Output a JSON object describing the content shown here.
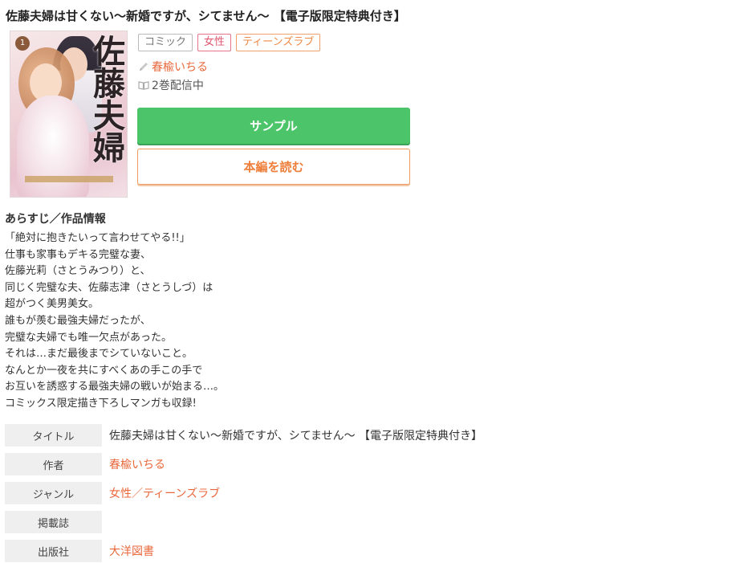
{
  "title": "佐藤夫婦は甘くない〜新婚ですが、シてません〜 【電子版限定特典付き】",
  "cover": {
    "volume_badge": "1",
    "title_text": "佐藤夫婦"
  },
  "tags": [
    "コミック",
    "女性",
    "ティーンズラブ"
  ],
  "author": "春楡いちる",
  "volumes": "2巻配信中",
  "buttons": {
    "sample": "サンプル",
    "read": "本編を読む"
  },
  "synopsis": {
    "heading": "あらすじ／作品情報",
    "lines": [
      "「絶対に抱きたいって言わせてやる!!」",
      "仕事も家事もデキる完璧な妻、",
      "佐藤光莉（さとうみつり）と、",
      "同じく完璧な夫、佐藤志津（さとうしづ）は",
      "超がつく美男美女。",
      "誰もが羨む最強夫婦だったが、",
      "完璧な夫婦でも唯一欠点があった。",
      "それは…まだ最後までシていないこと。",
      "なんとか一夜を共にすべくあの手この手で",
      "お互いを誘惑する最強夫婦の戦いが始まる…。",
      "コミックス限定描き下ろしマンガも収録!"
    ]
  },
  "info": {
    "title_label": "タイトル",
    "title_value": "佐藤夫婦は甘くない〜新婚ですが、シてません〜 【電子版限定特典付き】",
    "author_label": "作者",
    "author_value": "春楡いちる",
    "genre_label": "ジャンル",
    "genre_value": "女性／ティーンズラブ",
    "magazine_label": "掲載誌",
    "magazine_value": "",
    "publisher_label": "出版社",
    "publisher_value": "大洋図書"
  },
  "colors": {
    "accent_orange": "#e9683c",
    "sample_green": "#4cc46a",
    "tag_pink": "#e0566f",
    "tag_orange": "#ee8a44"
  }
}
